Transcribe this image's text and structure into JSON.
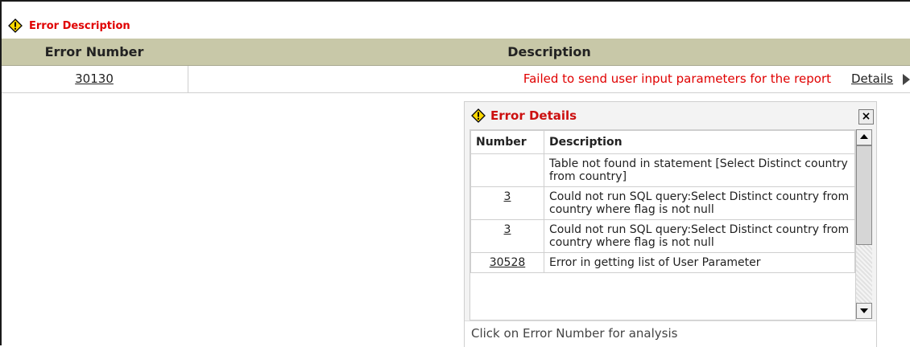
{
  "title": "Error Description",
  "columns": {
    "error_number": "Error Number",
    "description": "Description"
  },
  "row": {
    "error_number": "30130",
    "description": "Failed to send user input parameters for the report",
    "details_link": "Details"
  },
  "popup": {
    "title": "Error Details",
    "close_label": "×",
    "table_headers": {
      "number": "Number",
      "description": "Description"
    },
    "rows": [
      {
        "number": "",
        "description": "Table not found in statement [Select Distinct country from country]"
      },
      {
        "number": "3",
        "description": "Could not run SQL query:Select Distinct country from country where flag is not null"
      },
      {
        "number": "3",
        "description": "Could not run SQL query:Select Distinct country from country where flag is not null"
      },
      {
        "number": "30528",
        "description": "Error in getting list of User Parameter"
      }
    ],
    "footer": "Click on Error Number for analysis"
  },
  "colors": {
    "accent_red": "#e00000",
    "header_bg": "#c8c8a8",
    "popup_bg": "#f3f3f3"
  },
  "icons": {
    "title": "warning-icon",
    "popup": "warning-icon",
    "close": "close-icon",
    "details": "arrow-right-icon"
  }
}
